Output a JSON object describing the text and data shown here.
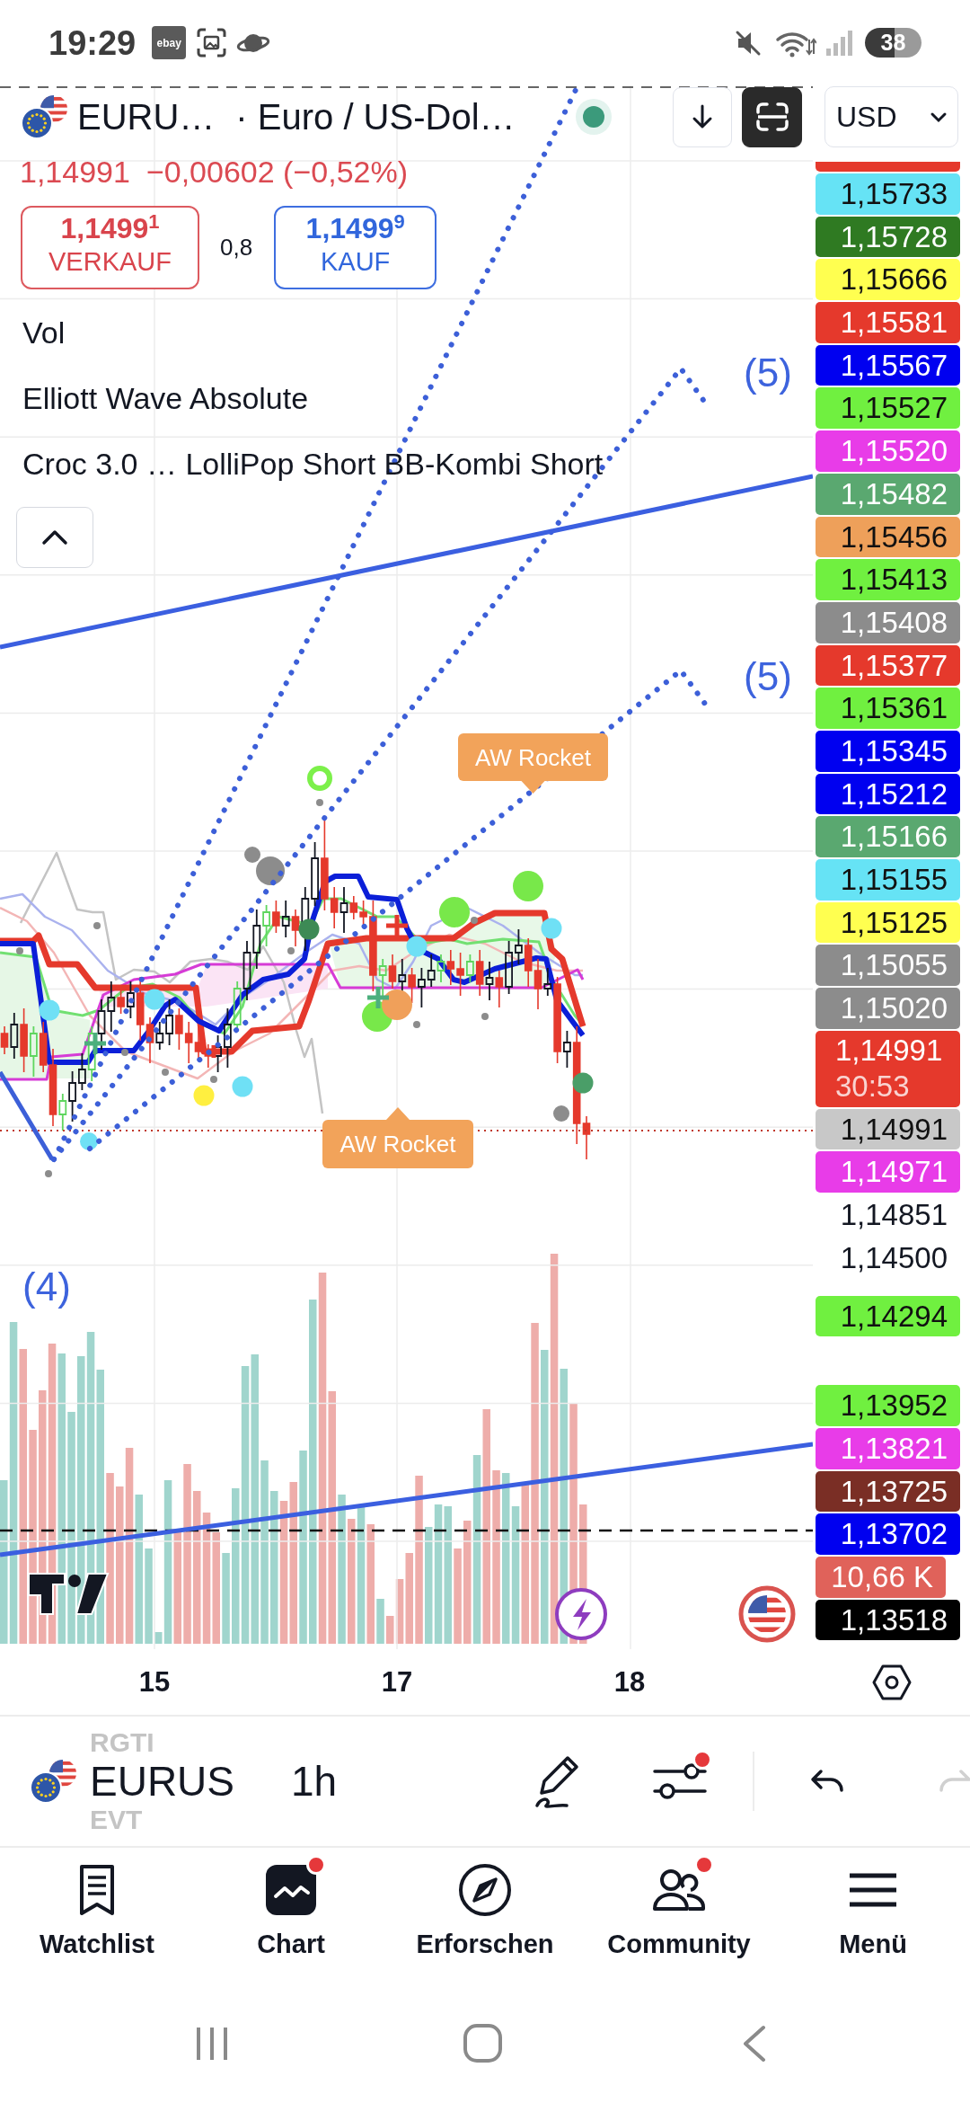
{
  "status_bar": {
    "time": "19:29",
    "app_icon": "ebay",
    "battery": "38"
  },
  "header": {
    "symbol": "EURU…",
    "description": "· Euro / US-Dol…",
    "currency": "USD"
  },
  "quote": {
    "price": "1,14991",
    "change": "−0,00602 (−0,52%)"
  },
  "trade": {
    "sell": {
      "price": "1,1499$^{1}$",
      "label": "VERKAUF"
    },
    "spread": "0,8",
    "buy": {
      "price": "1,1499$^{9}$",
      "label": "KAUF"
    }
  },
  "indicators": [
    "Vol",
    "Elliott Wave Absolute",
    "Croc 3.0 … LolliPop Short BB-Kombi Short"
  ],
  "chart": {
    "wave_labels": [
      "(5)",
      "(5)",
      "(4)"
    ],
    "callouts": [
      {
        "text": "AW Rocket",
        "kind": "below"
      },
      {
        "text": "AW Rocket",
        "kind": "above"
      }
    ]
  },
  "price_axis": [
    {
      "kind": "edge",
      "color": "#e5392c"
    },
    {
      "kind": "tag",
      "price": "1,15733",
      "color": "#66e3f5"
    },
    {
      "kind": "tag",
      "price": "1,15728",
      "color": "#2f7a22"
    },
    {
      "kind": "tag",
      "price": "1,15666",
      "color": "#ffff50"
    },
    {
      "kind": "tag",
      "price": "1,15581",
      "color": "#e5392c"
    },
    {
      "kind": "tag",
      "price": "1,15567",
      "color": "#0000f0"
    },
    {
      "kind": "tag",
      "price": "1,15527",
      "color": "#70f040"
    },
    {
      "kind": "tag",
      "price": "1,15520",
      "color": "#e83ce8"
    },
    {
      "kind": "tag",
      "price": "1,15482",
      "color": "#5aa870"
    },
    {
      "kind": "tag",
      "price": "1,15456",
      "color": "#eea05a"
    },
    {
      "kind": "tag",
      "price": "1,15413",
      "color": "#70f040"
    },
    {
      "kind": "tag",
      "price": "1,15408",
      "color": "#8c8c8c"
    },
    {
      "kind": "tag",
      "price": "1,15377",
      "color": "#e5392c"
    },
    {
      "kind": "tag",
      "price": "1,15361",
      "color": "#70f040"
    },
    {
      "kind": "tag",
      "price": "1,15345",
      "color": "#0000f0"
    },
    {
      "kind": "tag",
      "price": "1,15212",
      "color": "#0000f0"
    },
    {
      "kind": "tag",
      "price": "1,15166",
      "color": "#5aa870"
    },
    {
      "kind": "tag",
      "price": "1,15155",
      "color": "#66e3f5"
    },
    {
      "kind": "tag",
      "price": "1,15125",
      "color": "#ffff50"
    },
    {
      "kind": "tag",
      "price": "1,15055",
      "color": "#8c8c8c"
    },
    {
      "kind": "tag",
      "price": "1,15020",
      "color": "#8c8c8c"
    },
    {
      "kind": "tag",
      "price": "1,14991",
      "countdown": "30:53",
      "color": "#e5392c"
    },
    {
      "kind": "tag",
      "price": "1,14991",
      "color": "#c8c8c8"
    },
    {
      "kind": "tag",
      "price": "1,14971",
      "color": "#e83ce8"
    },
    {
      "kind": "tick",
      "price": "1,14851"
    },
    {
      "kind": "tick",
      "price": "1,14500"
    },
    {
      "kind": "tag",
      "price": "1,14294",
      "color": "#70f040"
    },
    {
      "kind": "tag",
      "price": "1,13952",
      "color": "#70f040"
    },
    {
      "kind": "tag",
      "price": "1,13821",
      "color": "#e83ce8"
    },
    {
      "kind": "tag",
      "price": "1,13725",
      "color": "#7a2e25"
    },
    {
      "kind": "tag",
      "price": "1,13702",
      "color": "#0000f0"
    },
    {
      "kind": "volume",
      "price": "10,66 K",
      "color": "#e0625a"
    },
    {
      "kind": "tag",
      "price": "1,13518",
      "color": "#000000"
    }
  ],
  "time_axis": [
    "15",
    "17",
    "18"
  ],
  "toolbar": {
    "symbols": [
      {
        "text": "RGTI",
        "selected": false
      },
      {
        "text": "EURUS",
        "selected": true
      },
      {
        "text": "EVT",
        "selected": false
      }
    ],
    "interval": "1h",
    "indicator_badge": true,
    "undo": {
      "disabled": false
    },
    "redo": {
      "disabled": true
    }
  },
  "bottom_nav": [
    {
      "kind": "watchlist",
      "label": "Watchlist",
      "selected": false,
      "notification": false
    },
    {
      "kind": "chart",
      "label": "Chart",
      "selected": true,
      "notification": true
    },
    {
      "kind": "explore",
      "label": "Erforschen",
      "selected": false,
      "notification": false
    },
    {
      "kind": "community",
      "label": "Community",
      "selected": false,
      "notification": true
    },
    {
      "kind": "menu",
      "label": "Menü",
      "selected": false,
      "notification": false
    }
  ]
}
